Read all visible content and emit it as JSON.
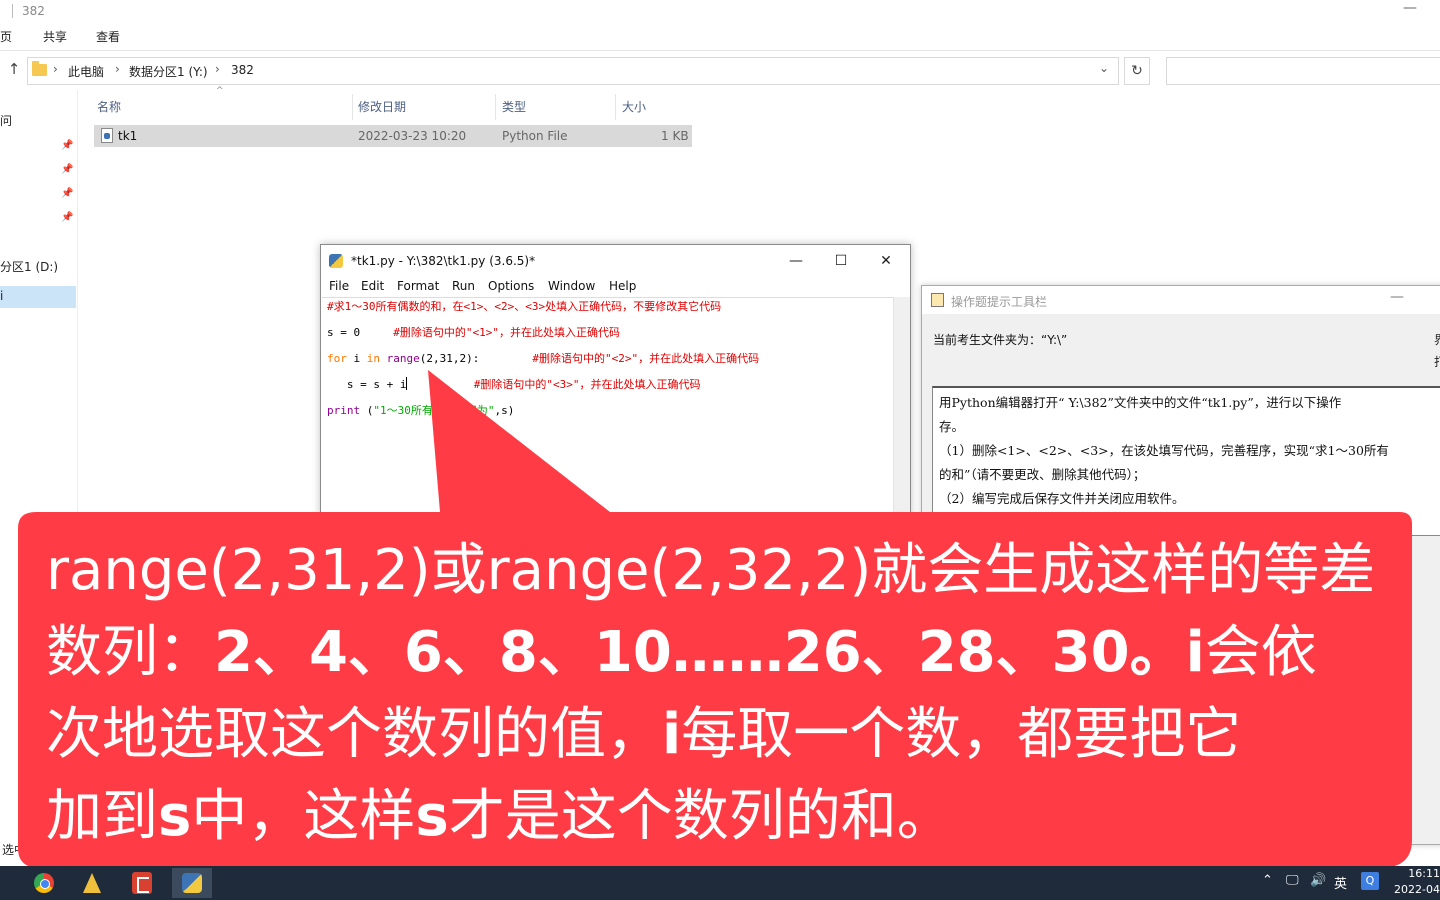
{
  "explorer": {
    "title": "382",
    "ribbon": [
      "页",
      "共享",
      "查看"
    ],
    "breadcrumb": [
      "此电脑",
      "数据分区1 (Y:)",
      "382"
    ],
    "nav": {
      "item1": "问",
      "item2": "分区1 (D:)",
      "selected_char": "i"
    },
    "columns": {
      "name": "名称",
      "modified": "修改日期",
      "type": "类型",
      "size": "大小"
    },
    "files": [
      {
        "name": "tk1",
        "modified": "2022-03-23 10:20",
        "type": "Python File",
        "size": "1 KB"
      }
    ],
    "status": "选中"
  },
  "idle": {
    "title": "*tk1.py - Y:\\382\\tk1.py (3.6.5)*",
    "menu": [
      "File",
      "Edit",
      "Format",
      "Run",
      "Options",
      "Window",
      "Help"
    ],
    "code": {
      "line1": "#求1～30所有偶数的和，在<1>、<2>、<3>处填入正确代码，不要修改其它代码",
      "line2_code": "s = 0     ",
      "line2_comment": "#删除语句中的\"<1>\"，并在此处填入正确代码",
      "line3_kw_for": "for",
      "line3_i": " i ",
      "line3_kw_in": "in",
      "line3_sp": " ",
      "line3_range": "range",
      "line3_args": "(2,31,2):        ",
      "line3_comment": "#删除语句中的\"<2>\"，并在此处填入正确代码",
      "line4_code": "   s = s + i",
      "line4_pad": "          ",
      "line4_comment": "#删除语句中的\"<3>\"，并在此处填入正确代码",
      "line5_print": "print",
      "line5_open": " (",
      "line5_str": "\"1～30所有偶数的和为\"",
      "line5_close": ",s)"
    }
  },
  "hint_tool": {
    "title": "操作题提示工具栏",
    "folder": "当前考生文件夹为：“Y:\\”",
    "right_cut1": "界",
    "right_cut2": "打",
    "lines": [
      "用Python编辑器打开“ Y:\\382”文件夹中的文件“tk1.py”，进行以下操作",
      "存。",
      "（1）删除<1>、<2>、<3>，在该处填写代码，完善程序，实现“求1～30所有",
      "的和”（请不要更改、删除其他代码）；",
      "（2）编写完成后保存文件并关闭应用软件。"
    ]
  },
  "callout": {
    "color": "#ff3b45",
    "l1": "range(2,31,2)或range(2,32,2)就会生成这样的等差",
    "l2a": "数列：",
    "l2b": "2、4、6、8、10……26、28、30。i",
    "l2c": "会依",
    "l3a": "次地选取这个数列的值，",
    "l3b": "i",
    "l3c": "每取一个数，都要把它",
    "l4a": "加到",
    "l4b": "s",
    "l4c": "中，这样",
    "l4d": "s",
    "l4e": "才是这个数列的和。"
  },
  "taskbar": {
    "ime": "英",
    "ime_badge": "Q",
    "time": "16:11",
    "date": "2022-04"
  }
}
